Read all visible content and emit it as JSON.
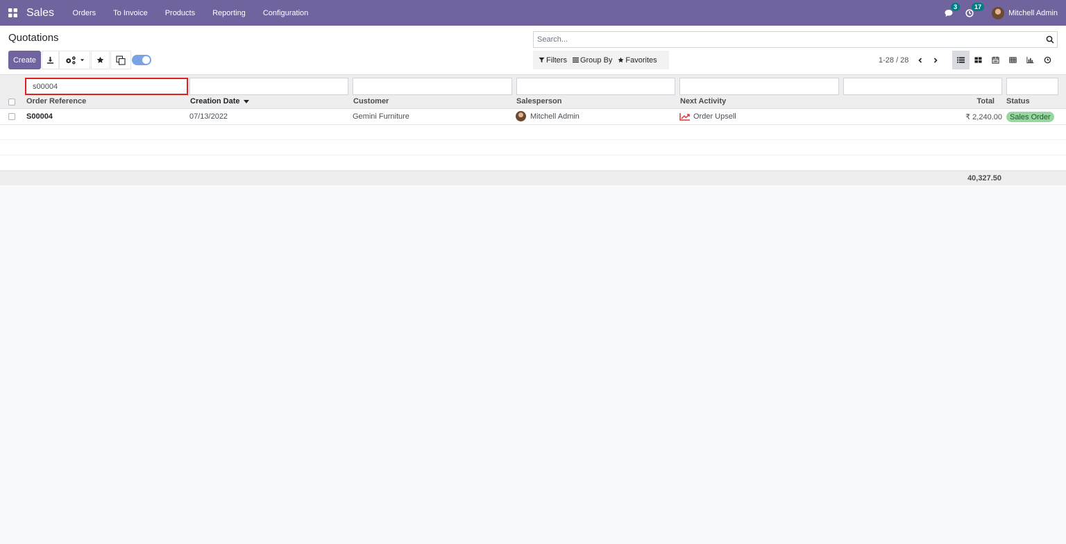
{
  "navbar": {
    "app_name": "Sales",
    "menu": [
      "Orders",
      "To Invoice",
      "Products",
      "Reporting",
      "Configuration"
    ],
    "messages_count": "3",
    "activities_count": "17",
    "user_name": "Mitchell Admin",
    "color": "#71639e"
  },
  "control_panel": {
    "title": "Quotations",
    "create_label": "Create",
    "search_placeholder": "Search...",
    "filters_label": "Filters",
    "groupby_label": "Group By",
    "favorites_label": "Favorites",
    "pager": "1-28 / 28"
  },
  "list": {
    "column_filters": {
      "order_reference": "s00004"
    },
    "columns": {
      "order_reference": "Order Reference",
      "creation_date": "Creation Date",
      "customer": "Customer",
      "salesperson": "Salesperson",
      "next_activity": "Next Activity",
      "total": "Total",
      "status": "Status"
    },
    "rows": [
      {
        "order_reference": "S00004",
        "creation_date": "07/13/2022",
        "customer": "Gemini Furniture",
        "salesperson": "Mitchell Admin",
        "next_activity": "Order Upsell",
        "total": "₹ 2,240.00",
        "status": "Sales Order"
      }
    ],
    "footer_total": "40,327.50",
    "status_color": "#99d6a1"
  }
}
